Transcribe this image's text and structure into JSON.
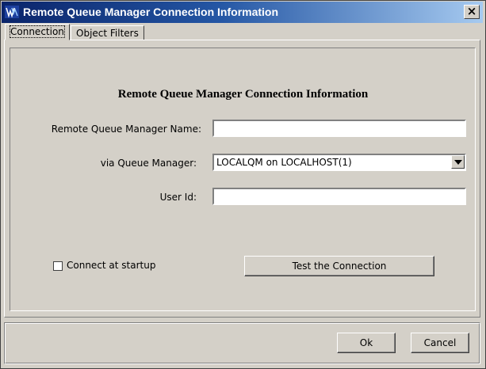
{
  "window": {
    "title": "Remote Queue Manager Connection Information",
    "close_glyph": "×"
  },
  "tabs": [
    {
      "label": "Connection",
      "active": true
    },
    {
      "label": "Object Filters",
      "active": false
    }
  ],
  "form": {
    "heading": "Remote Queue Manager Connection Information",
    "remote_qm_label": "Remote Queue Manager Name:",
    "remote_qm_value": "",
    "via_qm_label": "via Queue Manager:",
    "via_qm_value": "LOCALQM on LOCALHOST(1)",
    "user_id_label": "User Id:",
    "user_id_value": "",
    "connect_at_startup_label": "Connect at startup",
    "connect_at_startup_checked": false,
    "test_button_label": "Test the Connection"
  },
  "footer": {
    "ok_label": "Ok",
    "cancel_label": "Cancel"
  },
  "colors": {
    "titlebar_start": "#0a246a",
    "titlebar_end": "#a6caf0",
    "face": "#d4d0c8"
  }
}
